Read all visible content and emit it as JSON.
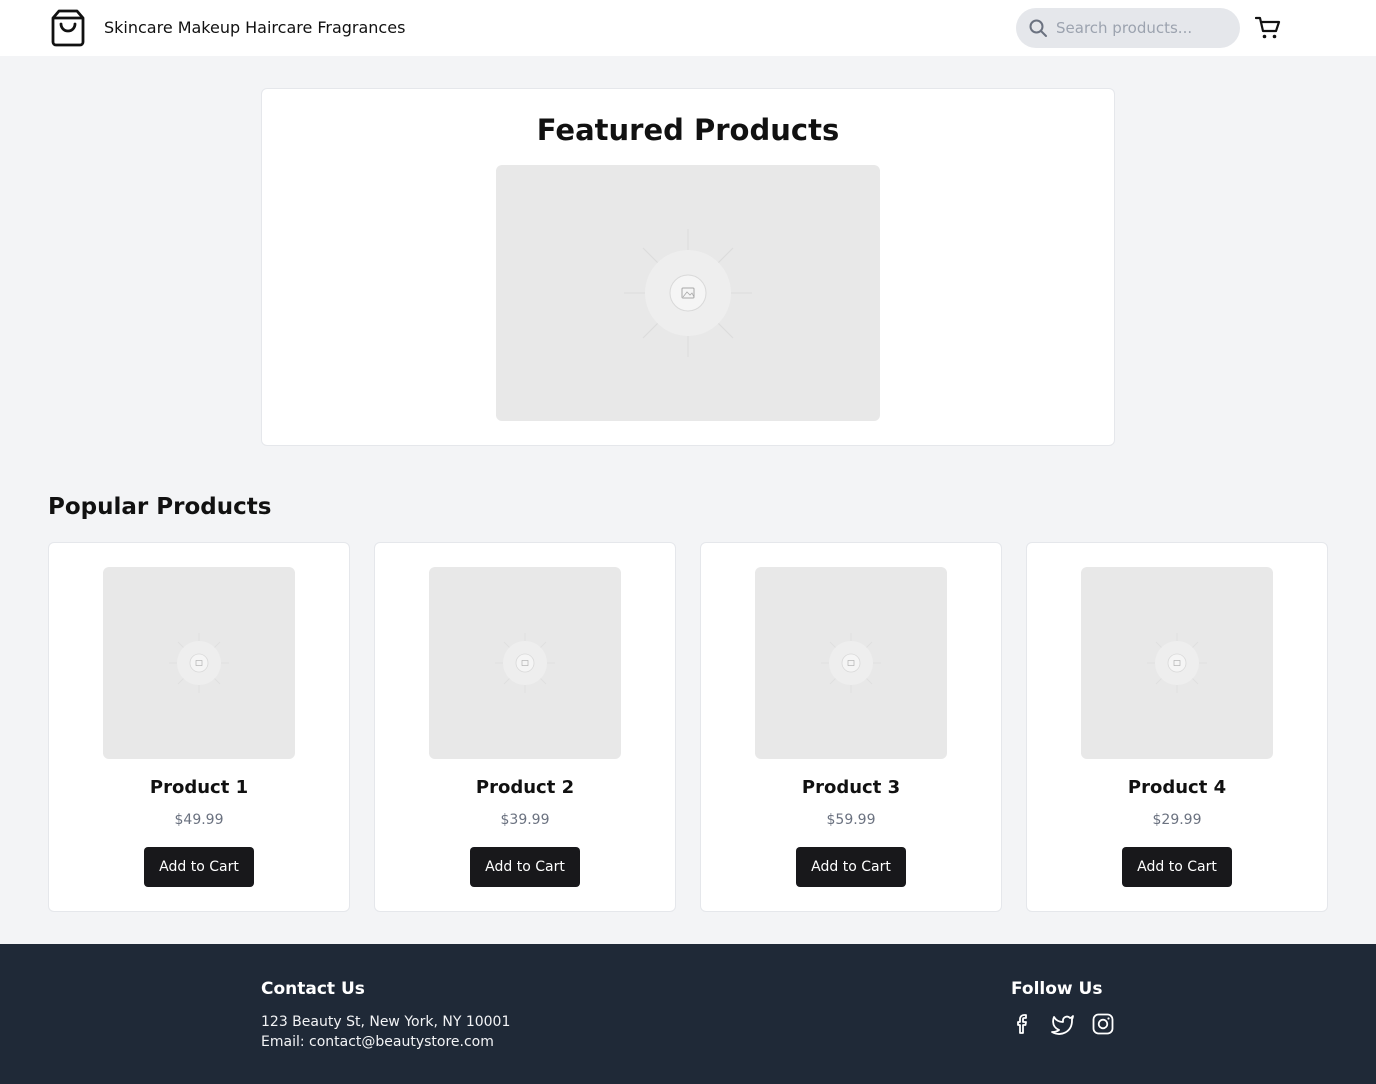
{
  "header": {
    "logo_icon": "shopping-bag-icon",
    "nav": [
      "Skincare",
      "Makeup",
      "Haircare",
      "Fragrances"
    ],
    "search_placeholder": "Search products...",
    "cart_icon": "shopping-cart-icon"
  },
  "featured": {
    "title": "Featured Products",
    "image_icon": "image-placeholder-icon"
  },
  "popular": {
    "title": "Popular Products",
    "products": [
      {
        "name": "Product 1",
        "price": "$49.99",
        "button": "Add to Cart"
      },
      {
        "name": "Product 2",
        "price": "$39.99",
        "button": "Add to Cart"
      },
      {
        "name": "Product 3",
        "price": "$59.99",
        "button": "Add to Cart"
      },
      {
        "name": "Product 4",
        "price": "$29.99",
        "button": "Add to Cart"
      }
    ]
  },
  "footer": {
    "contact_title": "Contact Us",
    "address": "123 Beauty St, New York, NY 10001",
    "email": "Email: contact@beautystore.com",
    "follow_title": "Follow Us",
    "social_icons": [
      "facebook-icon",
      "twitter-icon",
      "instagram-icon"
    ]
  },
  "colors": {
    "page_bg": "#f3f4f6",
    "button_bg": "#18181b",
    "footer_bg": "#1f2937",
    "placeholder_bg": "#e8e8e8"
  }
}
